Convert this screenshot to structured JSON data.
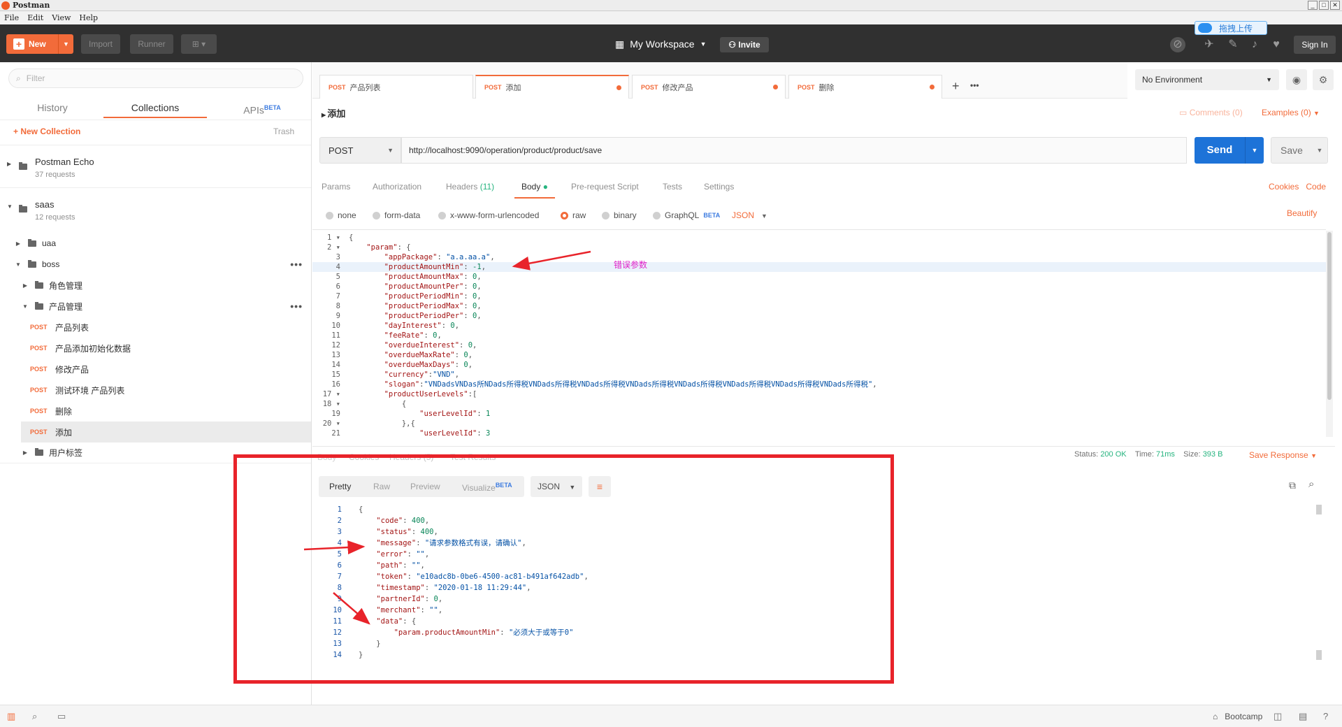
{
  "window": {
    "title": "Postman",
    "controls": [
      "_",
      "□",
      "✕"
    ]
  },
  "menu": [
    "File",
    "Edit",
    "View",
    "Help"
  ],
  "header": {
    "new_label": "New",
    "import_label": "Import",
    "runner_label": "Runner",
    "workspace_label": "My Workspace",
    "invite_label": "Invite",
    "signin_label": "Sign In",
    "upload_label": "拖拽上传"
  },
  "sidebar": {
    "filter_placeholder": "Filter",
    "tabs": [
      "History",
      "Collections",
      "APIs"
    ],
    "apis_badge": "BETA",
    "new_collection": "New Collection",
    "trash": "Trash",
    "collections": [
      {
        "name": "Postman Echo",
        "count": "37 requests"
      },
      {
        "name": "saas",
        "count": "12 requests"
      }
    ],
    "tree": {
      "uaa": "uaa",
      "boss": "boss",
      "role_mgmt": "角色管理",
      "product_mgmt": "产品管理",
      "requests": [
        {
          "method": "POST",
          "name": "产品列表"
        },
        {
          "method": "POST",
          "name": "产品添加初始化数据"
        },
        {
          "method": "POST",
          "name": "修改产品"
        },
        {
          "method": "POST",
          "name": "测试环境 产品列表"
        },
        {
          "method": "POST",
          "name": "删除"
        },
        {
          "method": "POST",
          "name": "添加"
        }
      ],
      "user_tags": "用户标签"
    }
  },
  "request_tabs": [
    {
      "method": "POST",
      "name": "产品列表"
    },
    {
      "method": "POST",
      "name": "添加"
    },
    {
      "method": "POST",
      "name": "修改产品"
    },
    {
      "method": "POST",
      "name": "删除"
    }
  ],
  "environment": "No Environment",
  "request": {
    "title": "添加",
    "comments": "Comments (0)",
    "examples": "Examples (0)",
    "method": "POST",
    "url": "http://localhost:9090/operation/product/product/save",
    "send": "Send",
    "save": "Save",
    "tabs": {
      "params": "Params",
      "auth": "Authorization",
      "headers": "Headers",
      "headers_count": "(11)",
      "body": "Body",
      "prereq": "Pre-request Script",
      "tests": "Tests",
      "settings": "Settings"
    },
    "cookies": "Cookies",
    "code": "Code",
    "body_types": [
      "none",
      "form-data",
      "x-www-form-urlencoded",
      "raw",
      "binary",
      "GraphQL"
    ],
    "graphql_badge": "BETA",
    "format": "JSON",
    "beautify": "Beautify",
    "body_lines": [
      "{",
      "    \"param\": {",
      "        \"appPackage\": \"a.a.aa.a\",",
      "        \"productAmountMin\": -1,",
      "        \"productAmountMax\": 0,",
      "        \"productAmountPer\": 0,",
      "        \"productPeriodMin\": 0,",
      "        \"productPeriodMax\": 0,",
      "        \"productPeriodPer\": 0,",
      "        \"dayInterest\": 0,",
      "        \"feeRate\": 0,",
      "        \"overdueInterest\": 0,",
      "        \"overdueMaxRate\": 0,",
      "        \"overdueMaxDays\": 0,",
      "        \"currency\":\"VND\",",
      "        \"slogan\":\"VNDadsVNDas所NDads所得税VNDads所得税VNDads所得税VNDads所得税VNDads所得税VNDads所得税VNDads所得税VNDads所得税\",",
      "        \"productUserLevels\":[",
      "            {",
      "                \"userLevelId\": 1",
      "            },{",
      "                \"userLevelId\": 3"
    ]
  },
  "annotation_label": "错误参数",
  "response": {
    "tabs": [
      "Body",
      "Cookies",
      "Headers (5)",
      "Test Results"
    ],
    "status_label": "Status:",
    "status_value": "200 OK",
    "time_label": "Time:",
    "time_value": "71ms",
    "size_label": "Size:",
    "size_value": "393 B",
    "save_response": "Save Response",
    "views": [
      "Pretty",
      "Raw",
      "Preview",
      "Visualize"
    ],
    "visualize_badge": "BETA",
    "format": "JSON",
    "body_lines": [
      "{",
      "    \"code\": 400,",
      "    \"status\": 400,",
      "    \"message\": \"请求参数格式有误，请确认\",",
      "    \"error\": \"\",",
      "    \"path\": \"\",",
      "    \"token\": \"e10adc8b-0be6-4500-ac81-b491af642adb\",",
      "    \"timestamp\": \"2020-01-18 11:29:44\",",
      "    \"partnerId\": 0,",
      "    \"merchant\": \"\",",
      "    \"data\": {",
      "        \"param.productAmountMin\": \"必须大于或等于0\"",
      "    }",
      "}"
    ]
  },
  "bottom": {
    "bootcamp": "Bootcamp"
  },
  "colors": {
    "accent": "#f26b3a",
    "send": "#1d73d8",
    "annotation": "#e8232a",
    "status_ok": "#26b47f"
  }
}
